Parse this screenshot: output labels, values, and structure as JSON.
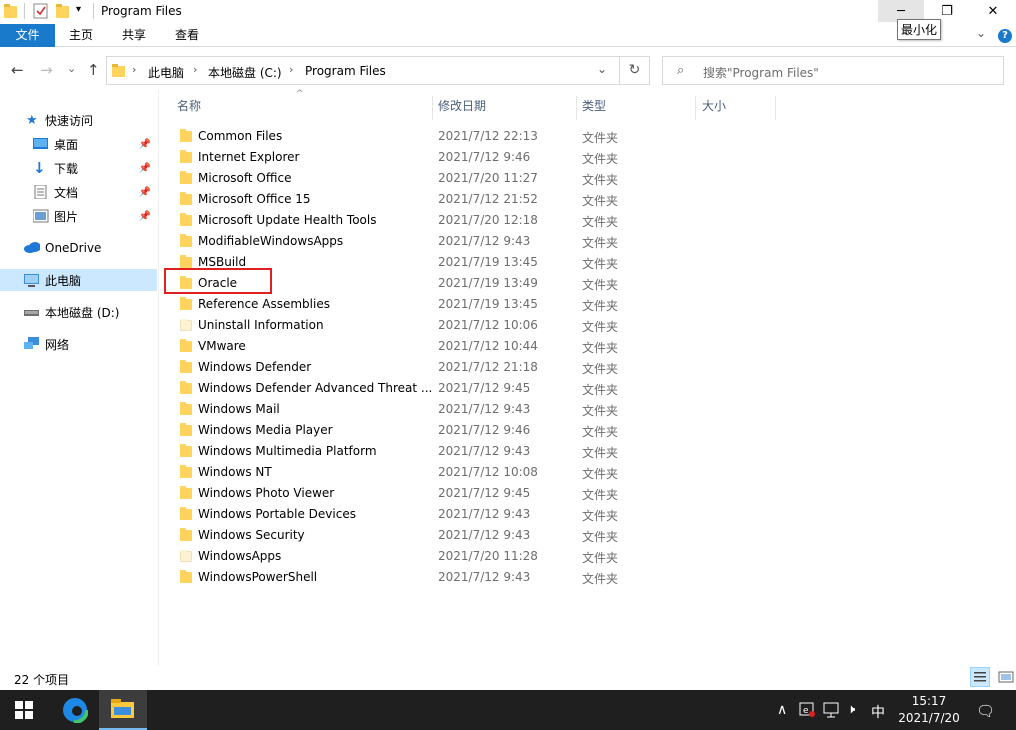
{
  "window": {
    "title": "Program Files",
    "minimize_tooltip": "最小化",
    "minimize_icon": "─",
    "maximize_icon": "❐",
    "close_icon": "✕"
  },
  "ribbon": {
    "tabs": [
      "文件",
      "主页",
      "共享",
      "查看"
    ],
    "expand_icon": "⌄",
    "help_icon": "?"
  },
  "address": {
    "segments": [
      "此电脑",
      "本地磁盘 (C:)",
      "Program Files"
    ],
    "separator": "›",
    "dropdown_icon": "⌄",
    "refresh_icon": "↻"
  },
  "nav": {
    "back_icon": "←",
    "forward_icon": "→",
    "history_icon": "⌄",
    "up_icon": "↑"
  },
  "search": {
    "placeholder": "搜索\"Program Files\"",
    "icon": "⌕"
  },
  "sidebar": {
    "items": [
      {
        "label": "快速访问"
      },
      {
        "label": "桌面"
      },
      {
        "label": "下载"
      },
      {
        "label": "文档"
      },
      {
        "label": "图片"
      },
      {
        "label": "OneDrive"
      },
      {
        "label": "此电脑"
      },
      {
        "label": "本地磁盘 (D:)"
      },
      {
        "label": "网络"
      }
    ],
    "pin_icon": "📌"
  },
  "columns": {
    "name": "名称",
    "date": "修改日期",
    "type": "类型",
    "size": "大小",
    "sort_icon": "^"
  },
  "files": [
    {
      "name": "Common Files",
      "date": "2021/7/12 22:13",
      "type": "文件夹"
    },
    {
      "name": "Internet Explorer",
      "date": "2021/7/12 9:46",
      "type": "文件夹"
    },
    {
      "name": "Microsoft Office",
      "date": "2021/7/20 11:27",
      "type": "文件夹"
    },
    {
      "name": "Microsoft Office 15",
      "date": "2021/7/12 21:52",
      "type": "文件夹"
    },
    {
      "name": "Microsoft Update Health Tools",
      "date": "2021/7/20 12:18",
      "type": "文件夹"
    },
    {
      "name": "ModifiableWindowsApps",
      "date": "2021/7/12 9:43",
      "type": "文件夹"
    },
    {
      "name": "MSBuild",
      "date": "2021/7/19 13:45",
      "type": "文件夹"
    },
    {
      "name": "Oracle",
      "date": "2021/7/19 13:49",
      "type": "文件夹"
    },
    {
      "name": "Reference Assemblies",
      "date": "2021/7/19 13:45",
      "type": "文件夹"
    },
    {
      "name": "Uninstall Information",
      "date": "2021/7/12 10:06",
      "type": "文件夹"
    },
    {
      "name": "VMware",
      "date": "2021/7/12 10:44",
      "type": "文件夹"
    },
    {
      "name": "Windows Defender",
      "date": "2021/7/12 21:18",
      "type": "文件夹"
    },
    {
      "name": "Windows Defender Advanced Threat ...",
      "date": "2021/7/12 9:45",
      "type": "文件夹"
    },
    {
      "name": "Windows Mail",
      "date": "2021/7/12 9:43",
      "type": "文件夹"
    },
    {
      "name": "Windows Media Player",
      "date": "2021/7/12 9:46",
      "type": "文件夹"
    },
    {
      "name": "Windows Multimedia Platform",
      "date": "2021/7/12 9:43",
      "type": "文件夹"
    },
    {
      "name": "Windows NT",
      "date": "2021/7/12 10:08",
      "type": "文件夹"
    },
    {
      "name": "Windows Photo Viewer",
      "date": "2021/7/12 9:45",
      "type": "文件夹"
    },
    {
      "name": "Windows Portable Devices",
      "date": "2021/7/12 9:43",
      "type": "文件夹"
    },
    {
      "name": "Windows Security",
      "date": "2021/7/12 9:43",
      "type": "文件夹"
    },
    {
      "name": "WindowsApps",
      "date": "2021/7/20 11:28",
      "type": "文件夹"
    },
    {
      "name": "WindowsPowerShell",
      "date": "2021/7/12 9:43",
      "type": "文件夹"
    }
  ],
  "status": {
    "item_count": "22 个项目"
  },
  "taskbar": {
    "ime": "中",
    "time": "15:17",
    "date": "2021/7/20",
    "tray_up_icon": "∧",
    "volume_icon": "🕨",
    "notification_icon": "🗨"
  }
}
